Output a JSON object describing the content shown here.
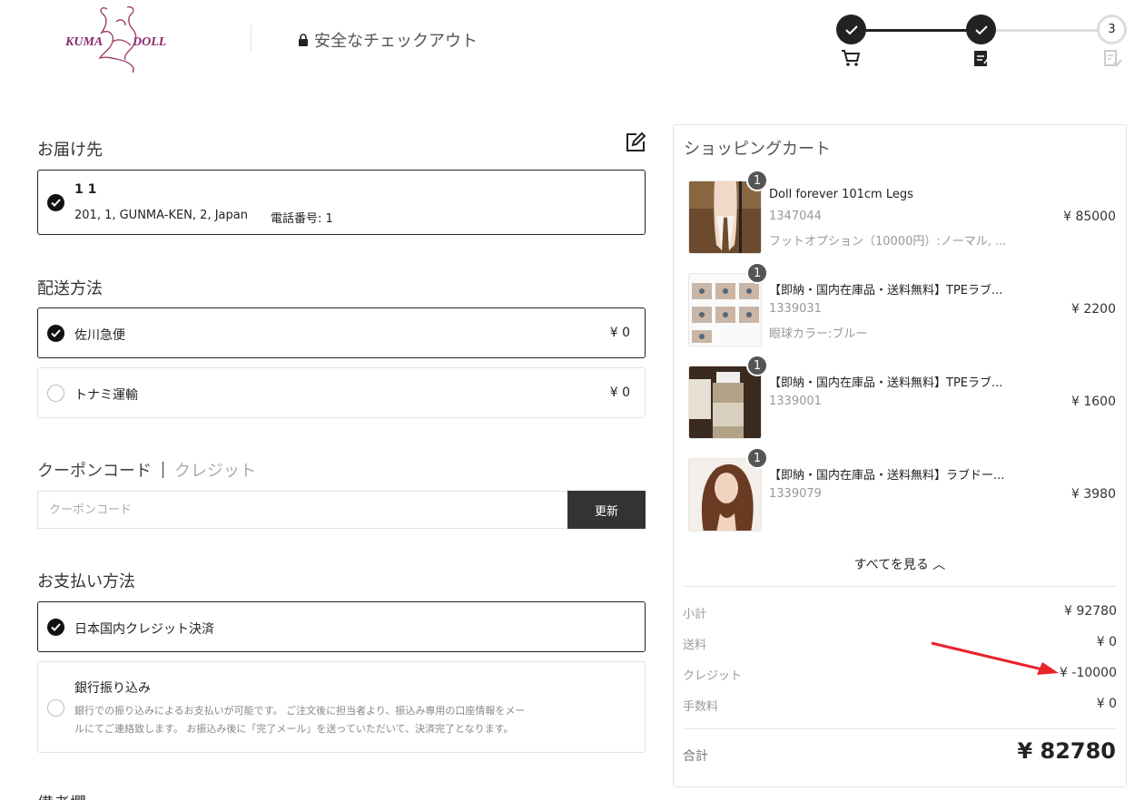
{
  "header": {
    "logo_text": "KUMA DOLL",
    "secure_label": "安全なチェックアウト",
    "steps": [
      {
        "state": "done",
        "icon": "cart-icon"
      },
      {
        "state": "done",
        "icon": "form-icon"
      },
      {
        "state": "current",
        "number": "3",
        "icon": "payment-icon"
      }
    ]
  },
  "shipping_address": {
    "title": "お届け先",
    "name": "1 1",
    "address": "201, 1, GUNMA-KEN, 2, Japan",
    "phone": "電話番号: 1"
  },
  "shipping_method": {
    "title": "配送方法",
    "options": [
      {
        "label": "佐川急便",
        "price": "¥ 0",
        "selected": true
      },
      {
        "label": "トナミ運輸",
        "price": "¥ 0",
        "selected": false
      }
    ]
  },
  "coupon": {
    "tab_coupon": "クーポンコード",
    "tab_credit": "クレジット",
    "placeholder": "クーポンコード",
    "button": "更新"
  },
  "payment": {
    "title": "お支払い方法",
    "options": [
      {
        "label": "日本国内クレジット決済",
        "selected": true
      },
      {
        "label": "銀行振り込み",
        "selected": false,
        "desc_line1": "銀行での振り込みによるお支払いが可能です。 ご注文後に担当者より、振込み専用の口座情報をメー",
        "desc_line2": "ルにてご連絡致します。 お振込み後に「完了メール」を送っていただいて、決済完了となります。"
      }
    ]
  },
  "remarks_title": "備考欄",
  "cart": {
    "title": "ショッピングカート",
    "items": [
      {
        "qty": "1",
        "name": "Doll forever 101cm Legs",
        "sku": "1347044",
        "price": "¥ 85000",
        "option": "フットオプション（10000円）:ノーマル, ..."
      },
      {
        "qty": "1",
        "name": "【即納・国内在庫品・送料無料】TPEラブ...",
        "sku": "1339031",
        "price": "¥ 2200",
        "option": "眼球カラー:ブルー"
      },
      {
        "qty": "1",
        "name": "【即納・国内在庫品・送料無料】TPEラブ...",
        "sku": "1339001",
        "price": "¥ 1600",
        "option": ""
      },
      {
        "qty": "1",
        "name": "【即納・国内在庫品・送料無料】ラブドー...",
        "sku": "1339079",
        "price": "¥ 3980",
        "option": ""
      }
    ],
    "view_all": "すべてを見る ︿",
    "summary": [
      {
        "label": "小計",
        "value": "¥ 92780"
      },
      {
        "label": "送料",
        "value": "¥ 0"
      },
      {
        "label": "クレジット",
        "value": "¥ -10000"
      },
      {
        "label": "手数料",
        "value": "¥ 0"
      }
    ],
    "total_label": "合計",
    "total_value": "¥ 82780"
  },
  "colors": {
    "accent": "#222222",
    "arrow": "#e8232a",
    "logo": "#8a2a6a"
  }
}
